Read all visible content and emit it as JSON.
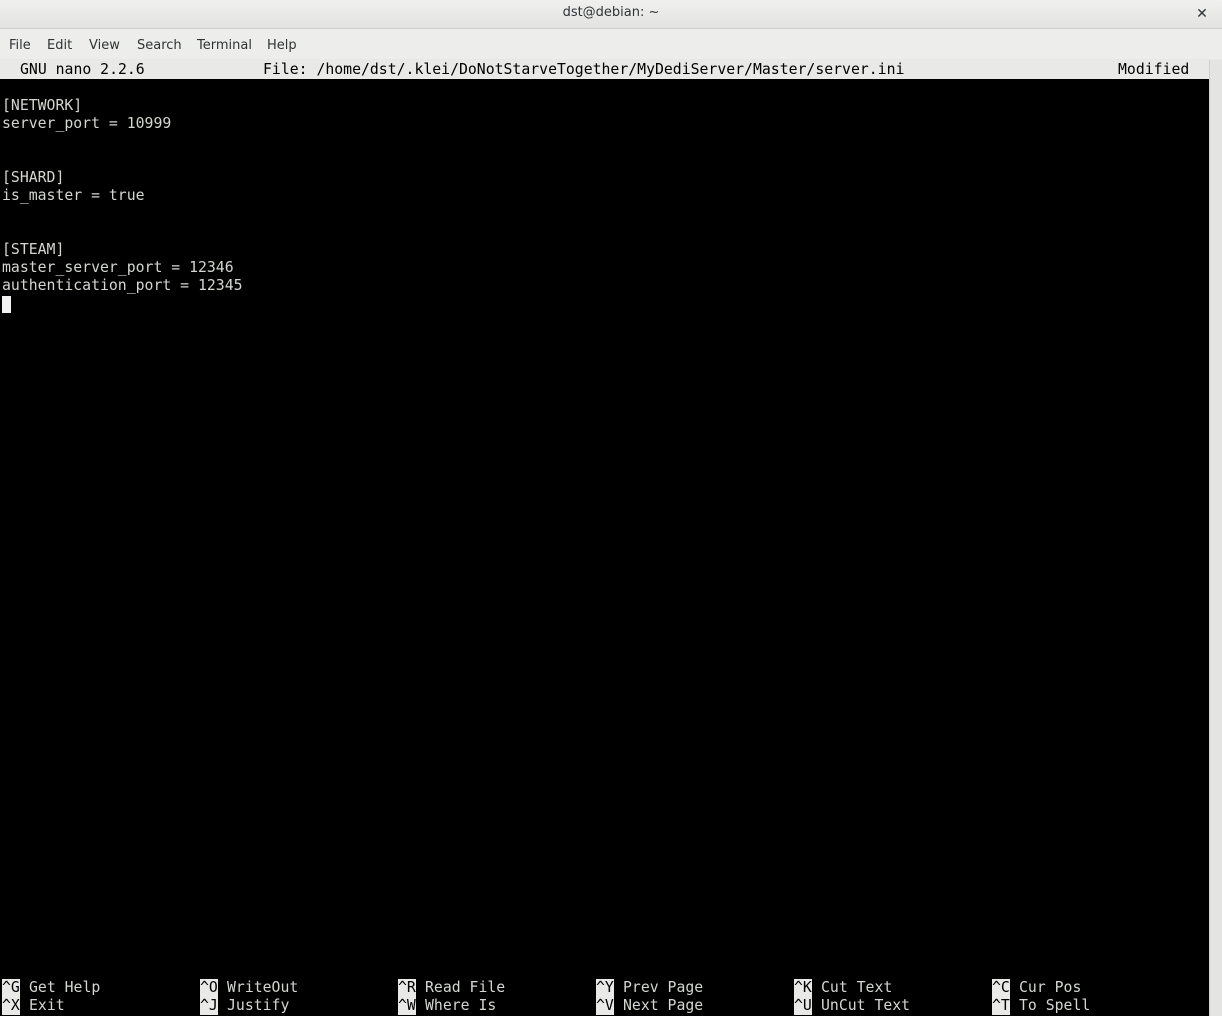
{
  "window": {
    "title": "dst@debian: ~",
    "close_glyph": "✕"
  },
  "menubar": {
    "items": [
      "File",
      "Edit",
      "View",
      "Search",
      "Terminal",
      "Help"
    ]
  },
  "nano": {
    "version": "GNU nano 2.2.6",
    "file": "File: /home/dst/.klei/DoNotStarveTogether/MyDediServer/Master/server.ini",
    "status": "Modified",
    "lines": [
      "[NETWORK]",
      "server_port = 10999",
      "",
      "",
      "[SHARD]",
      "is_master = true",
      "",
      "",
      "[STEAM]",
      "master_server_port = 12346",
      "authentication_port = 12345"
    ],
    "shortcuts_row1": [
      {
        "key": "^G",
        "label": "Get Help"
      },
      {
        "key": "^O",
        "label": "WriteOut"
      },
      {
        "key": "^R",
        "label": "Read File"
      },
      {
        "key": "^Y",
        "label": "Prev Page"
      },
      {
        "key": "^K",
        "label": "Cut Text"
      },
      {
        "key": "^C",
        "label": "Cur Pos"
      }
    ],
    "shortcuts_row2": [
      {
        "key": "^X",
        "label": "Exit"
      },
      {
        "key": "^J",
        "label": "Justify"
      },
      {
        "key": "^W",
        "label": "Where Is"
      },
      {
        "key": "^V",
        "label": "Next Page"
      },
      {
        "key": "^U",
        "label": "UnCut Text"
      },
      {
        "key": "^T",
        "label": "To Spell"
      }
    ]
  }
}
